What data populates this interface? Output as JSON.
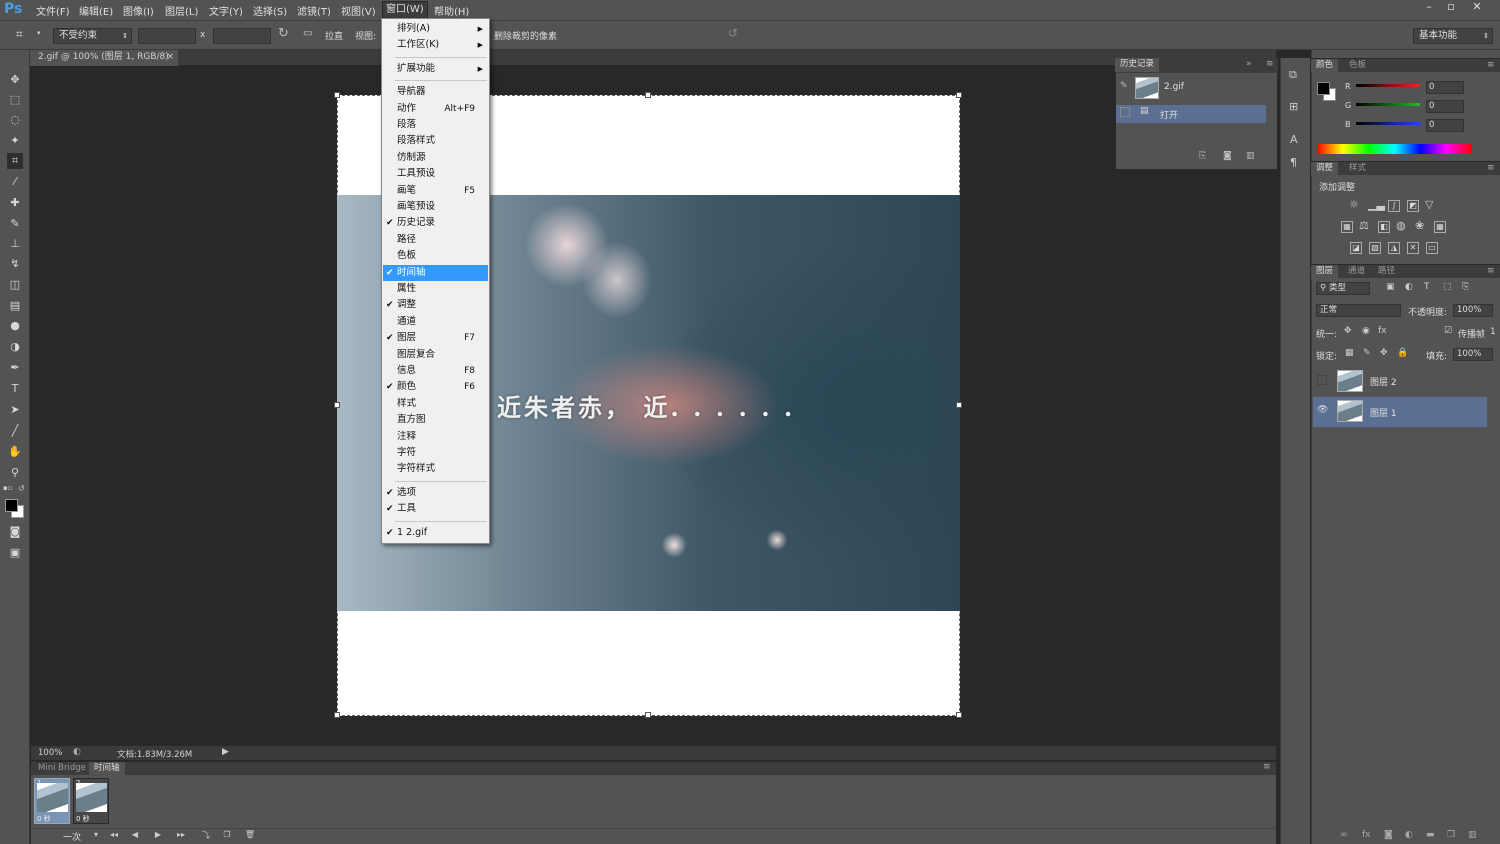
{
  "app": {
    "logo": "Ps"
  },
  "menubar": {
    "items": [
      "文件(F)",
      "编辑(E)",
      "图像(I)",
      "图层(L)",
      "文字(Y)",
      "选择(S)",
      "滤镜(T)",
      "视图(V)",
      "窗口(W)",
      "帮助(H)"
    ],
    "window_controls": {
      "minimize": "–",
      "restore": "▫",
      "close": "✕"
    }
  },
  "options_bar": {
    "constraint": "不受约束",
    "x_label": "x",
    "straighten": "拉直",
    "view_label": "视图:",
    "delete_cropped": "删除裁剪的像素",
    "workspace": "基本功能"
  },
  "document": {
    "tab_title": "2.gif @ 100% (图层 1, RGB/8)",
    "tab_close": "×",
    "overlay_text": "近朱者赤， 近. . . . . ."
  },
  "status": {
    "zoom": "100%",
    "doc_info": "文档:1.83M/3.26M"
  },
  "timeline": {
    "tabs": [
      "Mini Bridge",
      "时间轴"
    ],
    "frames": [
      {
        "num": "1",
        "delay": "0 秒"
      },
      {
        "num": "2",
        "delay": "0 秒"
      }
    ],
    "loop": "一次"
  },
  "window_menu": {
    "items": [
      {
        "label": "排列(A)",
        "submenu": true
      },
      {
        "label": "工作区(K)",
        "submenu": true
      },
      {
        "sep": true
      },
      {
        "label": "扩展功能",
        "submenu": true
      },
      {
        "sep": true
      },
      {
        "label": "导航器"
      },
      {
        "label": "动作",
        "shortcut": "Alt+F9"
      },
      {
        "label": "段落"
      },
      {
        "label": "段落样式"
      },
      {
        "label": "仿制源"
      },
      {
        "label": "工具预设"
      },
      {
        "label": "画笔",
        "shortcut": "F5"
      },
      {
        "label": "画笔预设"
      },
      {
        "label": "历史记录",
        "checked": true
      },
      {
        "label": "路径"
      },
      {
        "label": "色板"
      },
      {
        "label": "时间轴",
        "checked": true,
        "highlighted": true
      },
      {
        "label": "属性"
      },
      {
        "label": "调整",
        "checked": true
      },
      {
        "label": "通道"
      },
      {
        "label": "图层",
        "checked": true,
        "shortcut": "F7"
      },
      {
        "label": "图层复合"
      },
      {
        "label": "信息",
        "shortcut": "F8"
      },
      {
        "label": "颜色",
        "checked": true,
        "shortcut": "F6"
      },
      {
        "label": "样式"
      },
      {
        "label": "直方图"
      },
      {
        "label": "注释"
      },
      {
        "label": "字符"
      },
      {
        "label": "字符样式"
      },
      {
        "sep": true
      },
      {
        "label": "选项",
        "checked": true
      },
      {
        "label": "工具",
        "checked": true
      },
      {
        "sep": true
      },
      {
        "label": "1 2.gif",
        "checked": true
      }
    ]
  },
  "history": {
    "tab": "历史记录",
    "snapshot": "2.gif",
    "steps": [
      "打开"
    ]
  },
  "color_panel": {
    "tabs": [
      "颜色",
      "色板"
    ],
    "channels": [
      {
        "label": "R",
        "value": "0",
        "color": "#ff2020"
      },
      {
        "label": "G",
        "value": "0",
        "color": "#20c020"
      },
      {
        "label": "B",
        "value": "0",
        "color": "#2040ff"
      }
    ]
  },
  "adjust_panel": {
    "tabs": [
      "调整",
      "样式"
    ],
    "heading": "添加调整"
  },
  "layers_panel": {
    "tabs": [
      "图层",
      "通道",
      "路径"
    ],
    "filter": "类型",
    "blend_mode": "正常",
    "opacity_label": "不透明度:",
    "opacity": "100%",
    "unify_label": "统一:",
    "propagate_label": "传播帧",
    "propagate_value": "1",
    "lock_label": "锁定:",
    "fill_label": "填充:",
    "fill": "100%",
    "layers": [
      "图层 2",
      "图层 1"
    ]
  }
}
